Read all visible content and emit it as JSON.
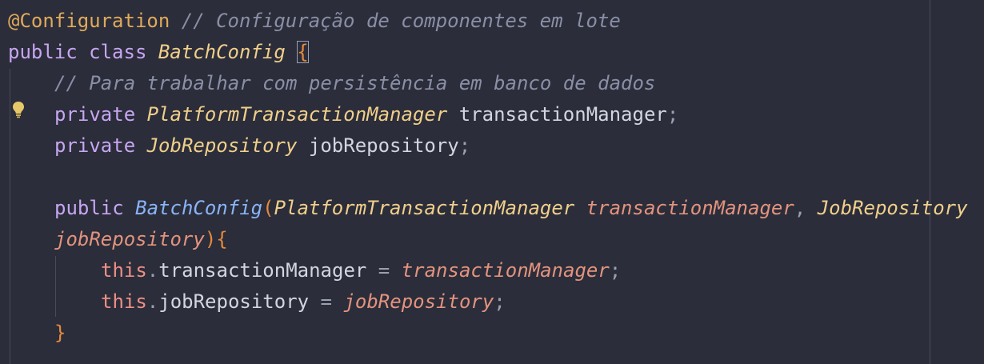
{
  "code": {
    "line1": {
      "annotation": "@Configuration",
      "comment": "// Configuração de componentes em lote"
    },
    "line2": {
      "kw_public": "public",
      "kw_class": "class",
      "class_name": "BatchConfig",
      "open_brace": "{"
    },
    "line3": {
      "comment": "// Para trabalhar com persistência em banco de dados"
    },
    "line4": {
      "kw_private": "private",
      "type": "PlatformTransactionManager",
      "field": "transactionManager",
      "semicolon": ";"
    },
    "line5": {
      "kw_private": "private",
      "type": "JobRepository",
      "field": "jobRepository",
      "semicolon": ";"
    },
    "line6": {
      "kw_public": "public",
      "ctor": "BatchConfig",
      "paren_open": "(",
      "type1": "PlatformTransactionManager",
      "param1": "transactionManager",
      "comma": ",",
      "type2": "JobRepository"
    },
    "line7": {
      "param2": "jobRepository",
      "paren_close": ")",
      "open_brace": "{"
    },
    "line8": {
      "this": "this",
      "dot": ".",
      "field": "transactionManager",
      "eq": "=",
      "param": "transactionManager",
      "semicolon": ";"
    },
    "line9": {
      "this": "this",
      "dot": ".",
      "field": "jobRepository",
      "eq": "=",
      "param": "jobRepository",
      "semicolon": ";"
    },
    "line10": {
      "close_brace": "}"
    }
  },
  "icons": {
    "gutter": "lightbulb-icon"
  },
  "colors": {
    "background": "#2b2d3a",
    "annotation": "#e0aa5a",
    "keyword": "#c7a6f2",
    "type": "#f0cf8a",
    "constructor": "#89b4f8",
    "parameter": "#e3937e",
    "comment": "#8a8fa6",
    "this_keyword": "#ef8f86",
    "brace": "#e38a3d"
  }
}
